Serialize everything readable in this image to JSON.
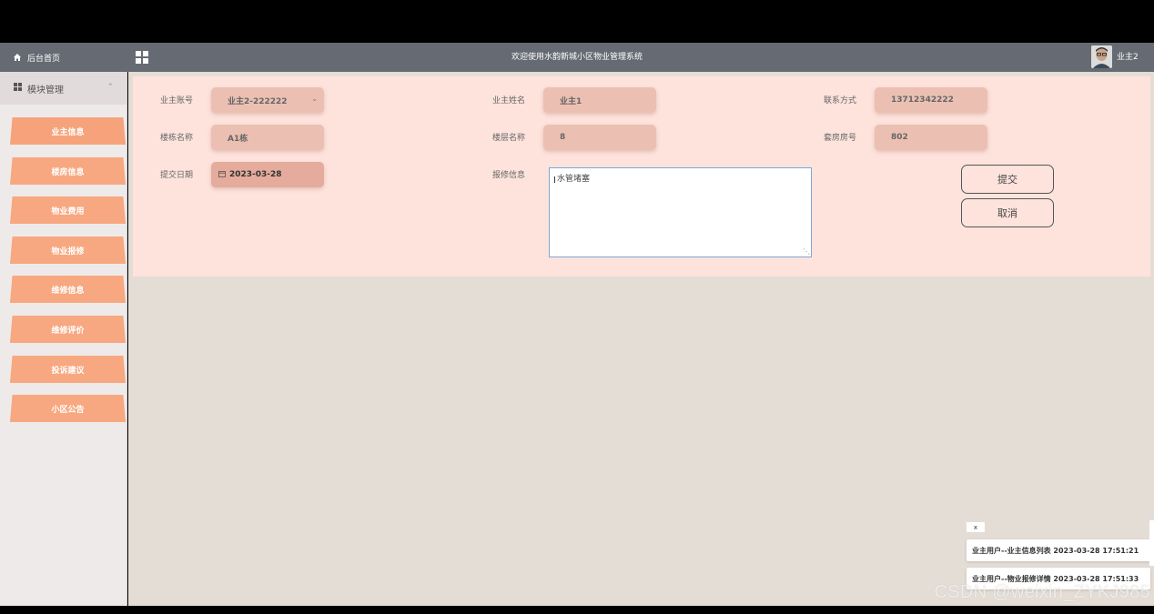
{
  "header": {
    "home_label": "后台首页",
    "title": "欢迎使用水韵新城小区物业管理系统",
    "username": "业主2"
  },
  "sidebar": {
    "module_title": "模块管理",
    "items": [
      {
        "label": "业主信息"
      },
      {
        "label": "楼房信息"
      },
      {
        "label": "物业费用"
      },
      {
        "label": "物业报修"
      },
      {
        "label": "维修信息"
      },
      {
        "label": "维修评价"
      },
      {
        "label": "投诉建议"
      },
      {
        "label": "小区公告"
      }
    ]
  },
  "form": {
    "owner_account": {
      "label": "业主账号",
      "value": "业主2-222222"
    },
    "owner_name": {
      "label": "业主姓名",
      "value": "业主1"
    },
    "contact": {
      "label": "联系方式",
      "value": "13712342222"
    },
    "building": {
      "label": "楼栋名称",
      "value": "A1栋"
    },
    "floor": {
      "label": "楼层名称",
      "value": "8"
    },
    "room": {
      "label": "套房房号",
      "value": "802"
    },
    "submit_date": {
      "label": "提交日期",
      "value": "2023-03-28"
    },
    "repair_info": {
      "label": "报修信息",
      "value": "水管堵塞"
    },
    "submit_label": "提交",
    "cancel_label": "取消"
  },
  "notifications": {
    "close_label": "x",
    "items": [
      {
        "text": "业主用户--业主信息列表 2023-03-28 17:51:21"
      },
      {
        "text": "业主用户--物业报修详情 2023-03-28 17:51:33"
      }
    ]
  },
  "watermark": "CSDN @weixin_ZYKJ985",
  "colors": {
    "topbar": "#666a72",
    "menu_item": "#f7a880",
    "form_panel": "#fde3dc",
    "field_box": "#ebc0b2"
  }
}
